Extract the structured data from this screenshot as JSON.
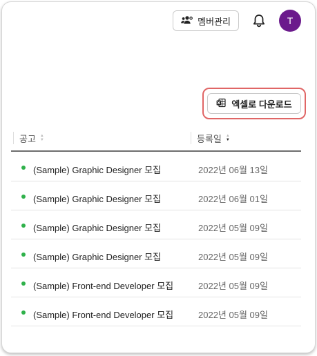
{
  "header": {
    "member_button_label": "멤버관리",
    "avatar_initial": "T",
    "avatar_color": "#6b1a8c"
  },
  "toolbar": {
    "download_label": "엑셀로 다운로드",
    "highlight_color": "#e06666"
  },
  "table": {
    "columns": [
      "공고",
      "등록일"
    ],
    "status_color": "#2fb14a",
    "rows": [
      {
        "title": "(Sample) Graphic Designer 모집",
        "date": "2022년 06월 13일"
      },
      {
        "title": "(Sample) Graphic Designer 모집",
        "date": "2022년 06월 01일"
      },
      {
        "title": "(Sample) Graphic Designer 모집",
        "date": "2022년 05월 09일"
      },
      {
        "title": "(Sample) Graphic Designer 모집",
        "date": "2022년 05월 09일"
      },
      {
        "title": "(Sample) Front-end Developer 모집",
        "date": "2022년 05월 09일"
      },
      {
        "title": "(Sample) Front-end Developer 모집",
        "date": "2022년 05월 09일"
      }
    ]
  }
}
